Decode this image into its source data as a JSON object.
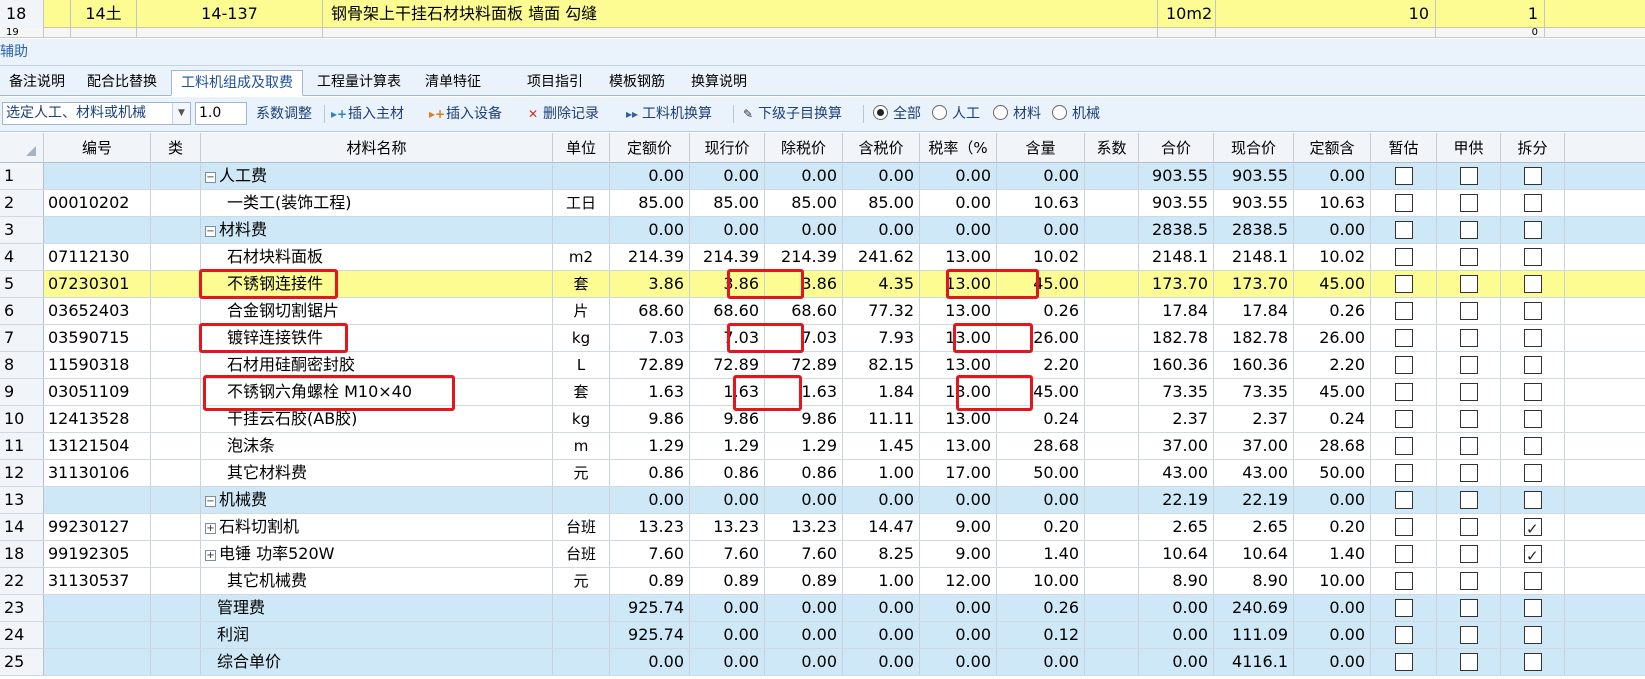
{
  "top_row": {
    "num": "18",
    "code": "14土",
    "item_no": "14-137",
    "name": "钢骨架上干挂石材块料面板 墙面 勾缝",
    "unit": "10m2",
    "qty": "10",
    "last": "1"
  },
  "top_row2": {
    "num": "19",
    "last": "0"
  },
  "panel_title": "辅助",
  "tabs": [
    "备注说明",
    "配合比替换",
    "工料机组成及取费",
    "工程量计算表",
    "清单特征",
    "项目指引",
    "模板钢筋",
    "换算说明"
  ],
  "toolbar": {
    "select_value": "选定人工、材料或机械",
    "coef_value": "1.0",
    "coef_label": "系数调整",
    "insert_main": "插入主材",
    "insert_equip": "插入设备",
    "delete_record": "删除记录",
    "labor_convert": "工料机换算",
    "sub_convert": "下级子目换算",
    "filter_all": "全部",
    "filter_labor": "人工",
    "filter_material": "材料",
    "filter_machine": "机械"
  },
  "columns": [
    "编号",
    "类",
    "材料名称",
    "单位",
    "定额价",
    "现行价",
    "除税价",
    "含税价",
    "税率（%",
    "含量",
    "系数",
    "合价",
    "现合价",
    "定额含",
    "暂估",
    "甲供",
    "拆分"
  ],
  "rows": [
    {
      "n": "1",
      "code": "",
      "name": "人工费",
      "group": true,
      "unit": "",
      "p1": "0.00",
      "p2": "0.00",
      "p3": "0.00",
      "p4": "0.00",
      "tax": "0.00",
      "qty": "0.00",
      "total": "903.55",
      "ctotal": "903.55",
      "dq": "0.00",
      "split": false,
      "style": "blue"
    },
    {
      "n": "2",
      "code": "00010202",
      "name": "一类工(装饰工程)",
      "unit": "工日",
      "p1": "85.00",
      "p2": "85.00",
      "p3": "85.00",
      "p4": "85.00",
      "tax": "0.00",
      "qty": "10.63",
      "total": "903.55",
      "ctotal": "903.55",
      "dq": "10.63",
      "split": false,
      "style": "white"
    },
    {
      "n": "3",
      "code": "",
      "name": "材料费",
      "group": true,
      "unit": "",
      "p1": "0.00",
      "p2": "0.00",
      "p3": "0.00",
      "p4": "0.00",
      "tax": "0.00",
      "qty": "0.00",
      "total": "2838.5",
      "ctotal": "2838.5",
      "dq": "0.00",
      "split": false,
      "style": "blue"
    },
    {
      "n": "4",
      "code": "07112130",
      "name": "石材块料面板",
      "unit": "m2",
      "p1": "214.39",
      "p2": "214.39",
      "p3": "214.39",
      "p4": "241.62",
      "tax": "13.00",
      "qty": "10.02",
      "total": "2148.1",
      "ctotal": "2148.1",
      "dq": "10.02",
      "split": false,
      "style": "white"
    },
    {
      "n": "5",
      "code": "07230301",
      "name": "不锈钢连接件",
      "unit": "套",
      "p1": "3.86",
      "p2": "3.86",
      "p3": "3.86",
      "p4": "4.35",
      "tax": "13.00",
      "qty": "45.00",
      "total": "173.70",
      "ctotal": "173.70",
      "dq": "45.00",
      "split": false,
      "style": "yellow"
    },
    {
      "n": "6",
      "code": "03652403",
      "name": "合金钢切割锯片",
      "unit": "片",
      "p1": "68.60",
      "p2": "68.60",
      "p3": "68.60",
      "p4": "77.32",
      "tax": "13.00",
      "qty": "0.26",
      "total": "17.84",
      "ctotal": "17.84",
      "dq": "0.26",
      "split": false,
      "style": "white"
    },
    {
      "n": "7",
      "code": "03590715",
      "name": "镀锌连接铁件",
      "unit": "kg",
      "p1": "7.03",
      "p2": "7.03",
      "p3": "7.03",
      "p4": "7.93",
      "tax": "13.00",
      "qty": "26.00",
      "total": "182.78",
      "ctotal": "182.78",
      "dq": "26.00",
      "split": false,
      "style": "white"
    },
    {
      "n": "8",
      "code": "11590318",
      "name": "石材用硅酮密封胶",
      "unit": "L",
      "p1": "72.89",
      "p2": "72.89",
      "p3": "72.89",
      "p4": "82.15",
      "tax": "13.00",
      "qty": "2.20",
      "total": "160.36",
      "ctotal": "160.36",
      "dq": "2.20",
      "split": false,
      "style": "white"
    },
    {
      "n": "9",
      "code": "03051109",
      "name": "不锈钢六角螺栓 M10×40",
      "unit": "套",
      "p1": "1.63",
      "p2": "1.63",
      "p3": "1.63",
      "p4": "1.84",
      "tax": "13.00",
      "qty": "45.00",
      "total": "73.35",
      "ctotal": "73.35",
      "dq": "45.00",
      "split": false,
      "style": "white"
    },
    {
      "n": "10",
      "code": "12413528",
      "name": "干挂云石胶(AB胶)",
      "unit": "kg",
      "p1": "9.86",
      "p2": "9.86",
      "p3": "9.86",
      "p4": "11.11",
      "tax": "13.00",
      "qty": "0.24",
      "total": "2.37",
      "ctotal": "2.37",
      "dq": "0.24",
      "split": false,
      "style": "white"
    },
    {
      "n": "11",
      "code": "13121504",
      "name": "泡沫条",
      "unit": "m",
      "p1": "1.29",
      "p2": "1.29",
      "p3": "1.29",
      "p4": "1.45",
      "tax": "13.00",
      "qty": "28.68",
      "total": "37.00",
      "ctotal": "37.00",
      "dq": "28.68",
      "split": false,
      "style": "white"
    },
    {
      "n": "12",
      "code": "31130106",
      "name": "其它材料费",
      "unit": "元",
      "p1": "0.86",
      "p2": "0.86",
      "p3": "0.86",
      "p4": "1.00",
      "tax": "17.00",
      "qty": "50.00",
      "total": "43.00",
      "ctotal": "43.00",
      "dq": "50.00",
      "split": false,
      "style": "white"
    },
    {
      "n": "13",
      "code": "",
      "name": "机械费",
      "group": true,
      "unit": "",
      "p1": "0.00",
      "p2": "0.00",
      "p3": "0.00",
      "p4": "0.00",
      "tax": "0.00",
      "qty": "0.00",
      "total": "22.19",
      "ctotal": "22.19",
      "dq": "0.00",
      "split": false,
      "style": "blue"
    },
    {
      "n": "14",
      "code": "99230127",
      "name": "石料切割机",
      "expand": true,
      "unit": "台班",
      "p1": "13.23",
      "p2": "13.23",
      "p3": "13.23",
      "p4": "14.47",
      "tax": "9.00",
      "qty": "0.20",
      "total": "2.65",
      "ctotal": "2.65",
      "dq": "0.20",
      "split": true,
      "style": "white"
    },
    {
      "n": "18",
      "code": "99192305",
      "name": "电锤 功率520W",
      "expand": true,
      "unit": "台班",
      "p1": "7.60",
      "p2": "7.60",
      "p3": "7.60",
      "p4": "8.25",
      "tax": "9.00",
      "qty": "1.40",
      "total": "10.64",
      "ctotal": "10.64",
      "dq": "1.40",
      "split": true,
      "style": "white"
    },
    {
      "n": "22",
      "code": "31130537",
      "name": "其它机械费",
      "unit": "元",
      "p1": "0.89",
      "p2": "0.89",
      "p3": "0.89",
      "p4": "1.00",
      "tax": "12.00",
      "qty": "10.00",
      "total": "8.90",
      "ctotal": "8.90",
      "dq": "10.00",
      "split": false,
      "style": "white"
    },
    {
      "n": "23",
      "code": "",
      "name": "管理费",
      "summary": true,
      "unit": "",
      "p1": "925.74",
      "p2": "0.00",
      "p3": "0.00",
      "p4": "0.00",
      "tax": "0.00",
      "qty": "0.26",
      "total": "0.00",
      "ctotal": "240.69",
      "dq": "0.00",
      "split": false,
      "style": "blue"
    },
    {
      "n": "24",
      "code": "",
      "name": "利润",
      "summary": true,
      "unit": "",
      "p1": "925.74",
      "p2": "0.00",
      "p3": "0.00",
      "p4": "0.00",
      "tax": "0.00",
      "qty": "0.12",
      "total": "0.00",
      "ctotal": "111.09",
      "dq": "0.00",
      "split": false,
      "style": "blue"
    },
    {
      "n": "25",
      "code": "",
      "name": "综合单价",
      "summary": true,
      "unit": "",
      "p1": "0.00",
      "p2": "0.00",
      "p3": "0.00",
      "p4": "0.00",
      "tax": "0.00",
      "qty": "0.00",
      "total": "0.00",
      "ctotal": "4116.1",
      "dq": "0.00",
      "split": false,
      "style": "blue"
    }
  ],
  "highlight_color": "#e4151b"
}
